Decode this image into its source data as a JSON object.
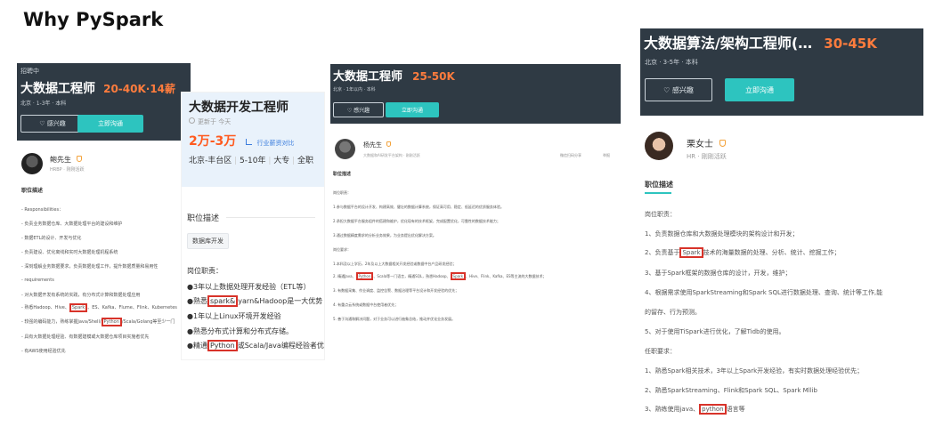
{
  "page_title": "Why PySpark",
  "card1": {
    "tag": "招聘中",
    "job_title": "大数据工程师",
    "salary": "20-40K·14薪",
    "meta": "北京 · 1-3年 · 本科",
    "interested": "♡ 感兴趣",
    "chat": "立即沟通",
    "recruiter_name": "鲍先生",
    "recruiter_role": "HRBP · 刚刚活跃",
    "section": "职位描述",
    "lines": [
      "- Responsibilities：",
      "- 负责业务数据仓库、大数据处理平台的建设和维护",
      "- 数据ETL的设计、开发与优化",
      "- 负责建设、优化离线和实时大数据处理机程系统",
      "- 深刻理解业务数据要求，负责数据处理工作，提升数据质量和易用性",
      "- requirements",
      "- 对大数据开发有系统的实践，有分布式计算和数据处理应用",
      "- 熟悉Hadoop、Hive、",
      "Spark",
      "、ES、Kafka、Flume、Flink、Kubernetes",
      "- 较强的编码能力，熟练掌握Java/Shell/",
      "Python",
      "/Scala/Golang等至少一门",
      "- 具有大数据处理经验、有数据建模或大数据仓库项目实施者优先",
      "- 有AWS使用经验优先"
    ]
  },
  "card2": {
    "job_title": "大数据开发工程师",
    "updated": "更新于 今天",
    "salary": "2万-3万",
    "salary_note": "行业薪资对比",
    "meta": [
      "北京-丰台区",
      "5-10年",
      "大专",
      "全职"
    ],
    "section": "职位描述",
    "tag": "数据库开发",
    "duty_header": "岗位职责：",
    "lines": [
      "●3年以上数据处理开发经验（ETL等）",
      "●熟悉",
      "spark&",
      "yarn&Hadoop是一大优势",
      "●1年以上Linux环境开发经验",
      "●熟悉分布式计算和分布式存储。",
      "●精通",
      "Python",
      "或Scala/Java编程经验者优先考虑"
    ]
  },
  "card3": {
    "job_title": "大数据工程师",
    "salary": "25-50K",
    "meta": "北京 · 1年以内 · 本科",
    "interested": "♡ 感兴趣",
    "chat": "立即沟通",
    "recruiter_name": "杨先生",
    "recruiter_role": "大数据和AI研发平台架构 · 刚刚活跃",
    "share": "微信扫码分享",
    "report": "举报",
    "section": "职位描述",
    "lines": [
      "岗位职责：",
      "1.参与数据平台的设计开发、构建高效、健壮的数据计算系统，保证高可用、稳定、低延迟的优质服务体验。",
      "2.承担大数据平台服务组件的搭建和维护，优化现有的技术框架，完成配置优化，可靠性的数据技术能力；",
      "3.通过数据精度需求的分析业务效果，为业务提出优化解决方案。",
      "岗位要求：",
      "1.本科及以上学历，2年及以上大数据相关开发经验或数据中台产品研发经验；",
      "2. 精通Java、",
      "Python",
      "、Scala等一门语言，精通SQL，熟悉Hadoop、",
      "Spark",
      "、Hive、Flink、Kafka、ES等主流的大数据技术；",
      "3. 有数据采集、作业调度、监控告警、数据治理等平台设计和开发经验的优先；",
      "4. 有重点云系统或数据中台使用者优先；",
      "5. 善于沟通和解决问题，对于业务可以进行抽象总结，推动并优化业务发展。"
    ]
  },
  "card4": {
    "job_title": "大数据算法/架构工程师(…",
    "salary": "30-45K",
    "meta": "北京 · 3-5年 · 本科",
    "interested": "♡ 感兴趣",
    "chat": "立即沟通",
    "recruiter_name": "栗女士",
    "recruiter_role": "HR · 刚刚活跃",
    "section": "职位描述",
    "lines": [
      "岗位职责：",
      "1、负责数据仓库和大数据处理模块的架构设计和开发；",
      "2、负责基于",
      "Spark",
      "技术的海量数据的处理、分析、统计、挖掘工作；",
      "3、基于Spark框架的数据仓库的设计，开发，维护；",
      "4、根据需求使用SparkStreaming和Spark SQL进行数据处理、查询、统计等工作,能",
      "的留存、行为预测。",
      "5、对于使用TiSpark进行优化，了解Tidb的使用。",
      "任职要求：",
      "1、熟悉Spark相关技术，3年以上Spark开发经验，有实时数据处理经验优先；",
      "2、熟悉SparkStreaming、Flink和Spark SQL、Spark Mllib",
      "3、熟练使用java、",
      "python",
      "语言等"
    ]
  }
}
